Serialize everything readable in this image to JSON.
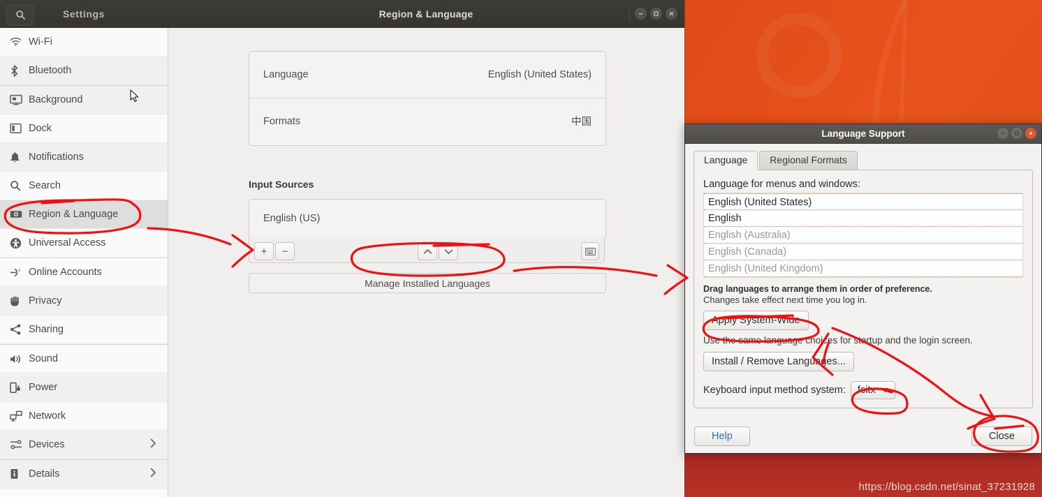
{
  "desktop": {
    "watermark": "https://blog.csdn.net/sinat_37231928",
    "accent_orange": "#dd4a17",
    "band_red": "#a92a24",
    "annotation_color": "#ee1111"
  },
  "settings_window": {
    "title": "Region & Language",
    "sidebar_title": "Settings",
    "search_icon": "search-icon",
    "window_controls": [
      {
        "name": "minimize-button",
        "glyph": "minimize-icon"
      },
      {
        "name": "maximize-button",
        "glyph": "maximize-icon"
      },
      {
        "name": "close-button",
        "glyph": "close-icon"
      }
    ],
    "sidebar_items": [
      {
        "label": "Wi-Fi",
        "icon": "wifi-icon",
        "active": false,
        "chevron": false
      },
      {
        "label": "Bluetooth",
        "icon": "bluetooth-icon",
        "active": false,
        "chevron": false
      },
      {
        "label": "Background",
        "icon": "background-icon",
        "active": false,
        "chevron": false
      },
      {
        "label": "Dock",
        "icon": "dock-icon",
        "active": false,
        "chevron": false
      },
      {
        "label": "Notifications",
        "icon": "bell-icon",
        "active": false,
        "chevron": false
      },
      {
        "label": "Search",
        "icon": "search-icon",
        "active": false,
        "chevron": false
      },
      {
        "label": "Region & Language",
        "icon": "region-language-icon",
        "active": true,
        "chevron": false
      },
      {
        "label": "Universal Access",
        "icon": "accessibility-icon",
        "active": false,
        "chevron": false
      },
      {
        "label": "Online Accounts",
        "icon": "online-accounts-icon",
        "active": false,
        "chevron": false
      },
      {
        "label": "Privacy",
        "icon": "privacy-hand-icon",
        "active": false,
        "chevron": false
      },
      {
        "label": "Sharing",
        "icon": "share-icon",
        "active": false,
        "chevron": false
      },
      {
        "label": "Sound",
        "icon": "speaker-icon",
        "active": false,
        "chevron": false
      },
      {
        "label": "Power",
        "icon": "battery-icon",
        "active": false,
        "chevron": false
      },
      {
        "label": "Network",
        "icon": "network-icon",
        "active": false,
        "chevron": false
      },
      {
        "label": "Devices",
        "icon": "devices-icon",
        "active": false,
        "chevron": true
      },
      {
        "label": "Details",
        "icon": "info-icon",
        "active": false,
        "chevron": true
      }
    ],
    "main": {
      "rows": [
        {
          "key": "Language",
          "value": "English (United States)"
        },
        {
          "key": "Formats",
          "value": "中国"
        }
      ],
      "input_sources_heading": "Input Sources",
      "input_sources": [
        "English (US)"
      ],
      "toolbar": {
        "add_label": "+",
        "remove_label": "−",
        "move_up_icon": "chevron-up-icon",
        "move_down_icon": "chevron-down-icon",
        "keyboard_icon": "keyboard-icon"
      },
      "manage_button": "Manage Installed Languages"
    }
  },
  "language_dialog": {
    "title": "Language Support",
    "window_controls": [
      {
        "name": "minimize-button",
        "glyph": "minimize-icon"
      },
      {
        "name": "maximize-button",
        "glyph": "maximize-icon"
      },
      {
        "name": "close-button",
        "glyph": "close-icon"
      }
    ],
    "tabs": [
      {
        "label": "Language",
        "active": true
      },
      {
        "label": "Regional Formats",
        "active": false
      }
    ],
    "panel_label": "Language for menus and windows:",
    "languages": [
      {
        "label": "English (United States)",
        "strong": true
      },
      {
        "label": "English",
        "strong": true
      },
      {
        "label": "English (Australia)",
        "strong": false
      },
      {
        "label": "English (Canada)",
        "strong": false
      },
      {
        "label": "English (United Kingdom)",
        "strong": false
      }
    ],
    "hint_bold": "Drag languages to arrange them in order of preference.",
    "hint": "Changes take effect next time you log in.",
    "apply_button": "Apply System-Wide",
    "apply_note": "Use the same language choices for startup and the login screen.",
    "install_button": "Install / Remove Languages...",
    "keyboard_label": "Keyboard input method system:",
    "keyboard_value": "fcitx",
    "help_button": "Help",
    "close_button": "Close"
  }
}
